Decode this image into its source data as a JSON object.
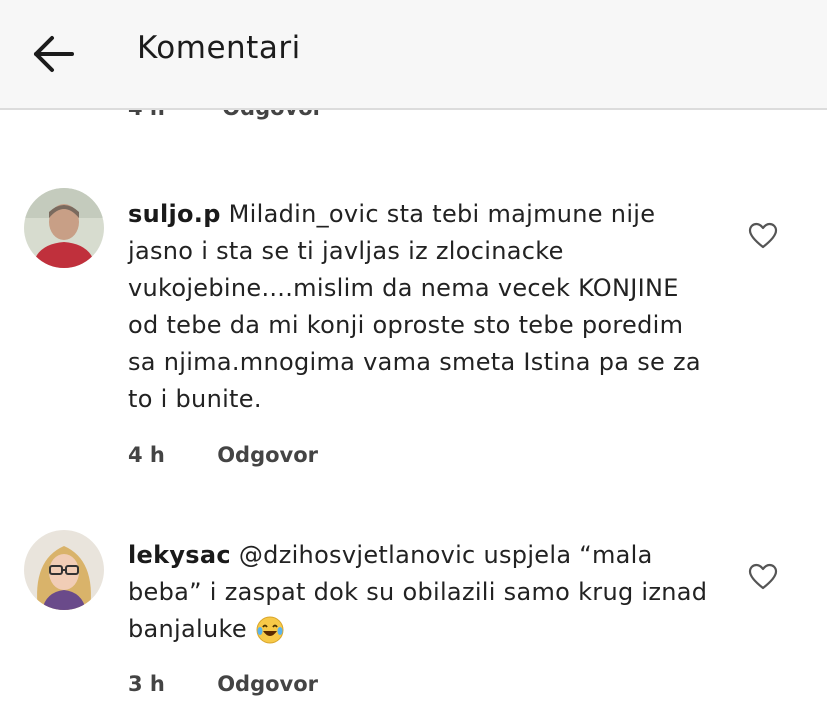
{
  "header": {
    "title": "Komentari"
  },
  "partial_comment": {
    "time": "4 h",
    "reply": "Odgovor"
  },
  "comments": [
    {
      "username": "suljo.p",
      "text": "Miladin_ovic sta tebi majmune nije jasno i sta se ti javljas iz zlocinacke vukojebine....mislim da nema vecek KONJINE od tebe da mi konji oproste sto tebe poredim sa njima.mnogima vama smeta Istina pa se za to i bunite.",
      "time": "4 h",
      "reply": "Odgovor"
    },
    {
      "username": "lekysac",
      "text": "@dzihosvjetlanovic uspjela “mala beba” i zaspat dok su obilazili samo krug iznad banjaluke",
      "emoji": "laughing-tears-emoji",
      "time": "3 h",
      "reply": "Odgovor"
    }
  ]
}
